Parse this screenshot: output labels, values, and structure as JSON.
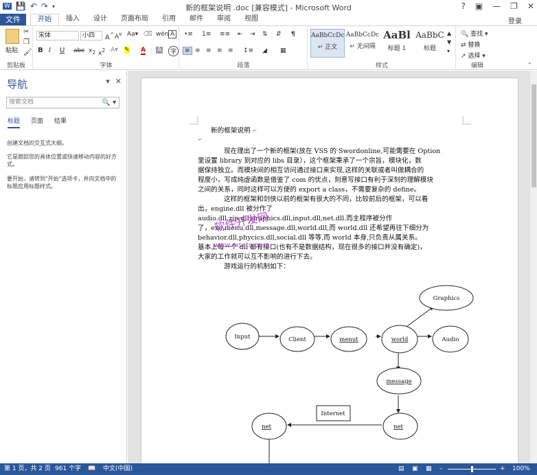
{
  "window": {
    "title": "新的框架说明 .doc [兼容模式] - Microsoft Word",
    "signin": "登录"
  },
  "tabs": {
    "file": "文件",
    "items": [
      "开始",
      "插入",
      "设计",
      "页面布局",
      "引用",
      "邮件",
      "审阅",
      "视图"
    ],
    "active": "开始"
  },
  "ribbon": {
    "clipboard": {
      "paste": "粘贴",
      "label": "剪贴板"
    },
    "font": {
      "name": "宋体",
      "size": "小四",
      "label": "字体"
    },
    "paragraph": {
      "label": "段落"
    },
    "styles": {
      "label": "样式",
      "items": [
        {
          "sample": "AaBbCcDc",
          "name": "↵ 正文"
        },
        {
          "sample": "AaBbCcDc",
          "name": "↵ 无间隔"
        },
        {
          "sample": "AaBl",
          "name": "标题 1"
        },
        {
          "sample": "AaBbC",
          "name": "标题"
        }
      ]
    },
    "editing": {
      "find": "查找",
      "replace": "替换",
      "select": "选择",
      "label": "编辑"
    }
  },
  "nav": {
    "title": "导航",
    "search_placeholder": "搜索文档",
    "tabs": [
      "标题",
      "页面",
      "结果"
    ],
    "hint1": "创建文档的交互式大纲。",
    "hint2": "它是跟踪您的具体位置或快速移动内容的好方式。",
    "hint3": "要开始，请转到\"开始\"选项卡，并向文档中的标题应用标题样式。"
  },
  "document": {
    "heading": "新的框架说明",
    "lines": [
      "现在理出了一个新的框架(放在 VSS 的 Swordonline,可能需要在 Option",
      "里设置 library 到对应的 libs 目录），这个框架秉承了一个宗旨，模块化，数",
      "据保持独立。而模块间的相互访问通过接口来实现,这样的关联或者叫做耦合的",
      "程度小，写成纯虚函数是借鉴了 com 的优点，刻意写接口有利于深刻的理解模块",
      "之间的关系，同时这样可以方便的 export a class，不需要复杂的 define。",
      "这样的框架和剑侠以前的框架有很大的不同，比较前后的框架，可以看",
      "出，engine.dll 被分作了",
      "audio.dll,zip.dll,graphics.dll,input.dll,net.dll.而主程序被分作",
      "了，exe,menu.dll,message.dll,world.dll,而 world.dll 还希望再往下细分为",
      "behavior.dll,phycics.dll,social.dll 等等,而 world 本身,只负责从属关系。",
      "基本上每一个 dll 都有接口(也有不是数据结构，现在很多的接口并没有确定)，",
      "大家的工作就可以互不影响的进行下去。",
      "游戏运行的机制如下："
    ],
    "watermark_main": "软件开发网",
    "watermark_url": "www.mscto.com"
  },
  "diagram": {
    "nodes": [
      "Input",
      "Client",
      "menut",
      "world",
      "Audio",
      "Graphics",
      "message",
      "net",
      "net"
    ],
    "box_label": "Internet"
  },
  "status": {
    "page": "第 1 页，共 2 页",
    "words": "961 个字",
    "lang": "中文(中国)",
    "zoom": "100%"
  },
  "colors": {
    "accent": "#2b579a",
    "watermark": "#b02fd6"
  }
}
